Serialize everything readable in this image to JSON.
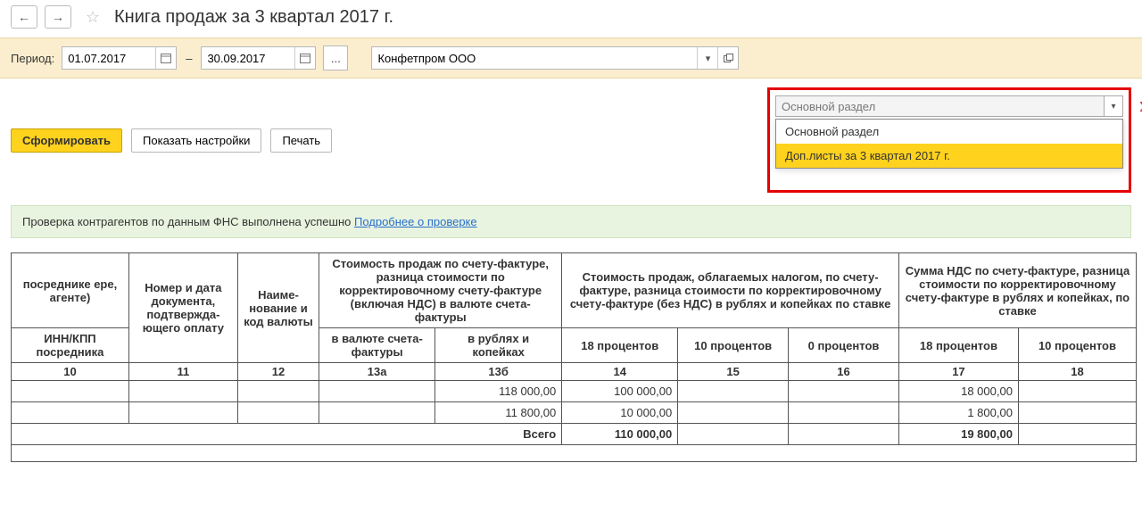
{
  "title": "Книга продаж за 3 квартал 2017 г.",
  "period": {
    "label": "Период:",
    "from": "01.07.2017",
    "to": "30.09.2017",
    "dash": "–",
    "dots": "..."
  },
  "organization": "Конфетпром ООО",
  "buttons": {
    "generate": "Сформировать",
    "show_settings": "Показать настройки",
    "print": "Печать"
  },
  "section_dropdown": {
    "selected": "Основной раздел",
    "items": [
      "Основной раздел",
      "Доп.листы за 3 квартал 2017 г."
    ],
    "highlight_index": 1
  },
  "check_bar": {
    "text": "Проверка контрагентов по данным ФНС выполнена успешно ",
    "link": "Подробнее о проверке"
  },
  "table": {
    "head_group": {
      "c10_top": "посреднике ере, агенте)",
      "c10_sub": "ИНН/КПП посредника",
      "c11": "Номер и дата документа, подтвержда­ющего оплату",
      "c12": "Наиме­нование и код валюты",
      "c13_top": "Стоимость продаж по счету-фактуре, разница стоимости по корректировочному счету-фактуре (включая НДС) в валюте счета-фактуры",
      "c13a": "в валюте счета-фактуры",
      "c13b": "в рублях и копейках",
      "c14_16_top": "Стоимость продаж, облагаемых налогом, по счету-фактуре, разница стоимости по корректи­ровочному счету-фактуре (без НДС) в рублях и копейках по ставке",
      "c14": "18 процентов",
      "c15": "10 процентов",
      "c16": "0 процентов",
      "c17_18_top": "Сумма НДС по счету-фактуре, разница стоимости по корректи­ровочному счету-фактуре в руб­лях и копейках, по ставке",
      "c17": "18 процентов",
      "c18": "10 процентов"
    },
    "col_nums": [
      "10",
      "11",
      "12",
      "13а",
      "13б",
      "14",
      "15",
      "16",
      "17",
      "18"
    ],
    "rows": [
      {
        "c13b": "118 000,00",
        "c14": "100 000,00",
        "c17": "18 000,00"
      },
      {
        "c13b": "11 800,00",
        "c14": "10 000,00",
        "c17": "1 800,00"
      }
    ],
    "total": {
      "label": "Всего",
      "c14": "110 000,00",
      "c17": "19 800,00"
    }
  }
}
